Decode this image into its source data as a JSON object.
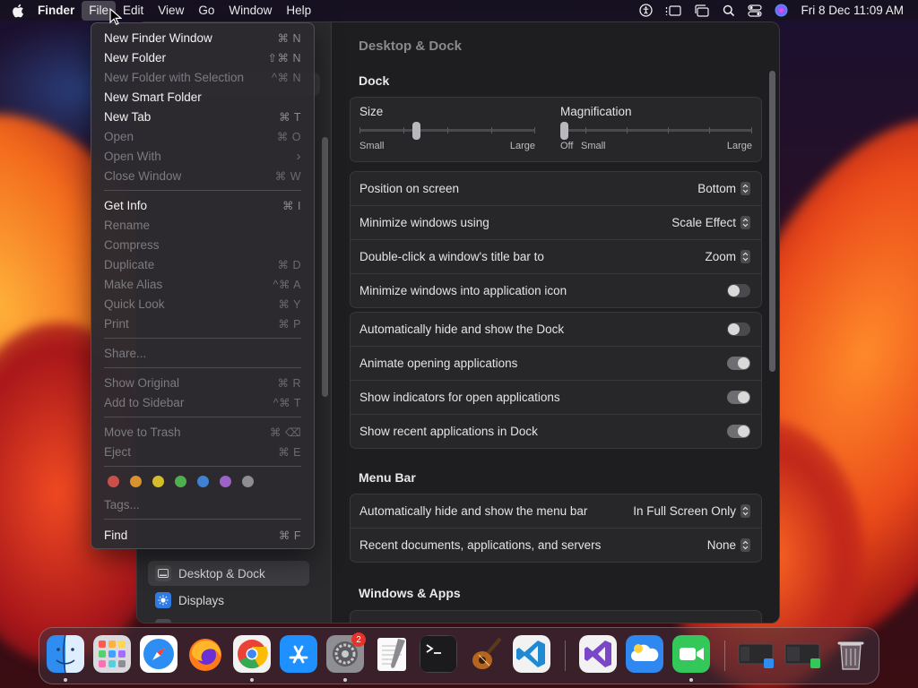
{
  "menubar": {
    "app_name": "Finder",
    "menus": [
      "File",
      "Edit",
      "View",
      "Go",
      "Window",
      "Help"
    ],
    "active_menu": "File",
    "clock": "Fri 8 Dec  11:09 AM"
  },
  "settings": {
    "pane_title": "Desktop & Dock",
    "sidebar": {
      "items": [
        {
          "label": "Desktop & Dock",
          "icon": "desktop-dock-icon",
          "selected": true
        },
        {
          "label": "Displays",
          "icon": "displays-icon",
          "selected": false
        }
      ]
    },
    "dock_section": {
      "title": "Dock",
      "size_slider": {
        "label": "Size",
        "min_label": "Small",
        "max_label": "Large",
        "value": 0.33
      },
      "magnification_slider": {
        "label": "Magnification",
        "off_label": "Off",
        "min_label": "Small",
        "max_label": "Large",
        "value": 0.0
      },
      "position_row": {
        "label": "Position on screen",
        "value": "Bottom"
      },
      "minimize_row": {
        "label": "Minimize windows using",
        "value": "Scale Effect"
      },
      "double_click_row": {
        "label": "Double-click a window's title bar to",
        "value": "Zoom"
      },
      "minimize_into_icon": {
        "label": "Minimize windows into application icon",
        "on": false
      },
      "auto_hide_dock": {
        "label": "Automatically hide and show the Dock",
        "on": false
      },
      "animate_opening": {
        "label": "Animate opening applications",
        "on": true
      },
      "show_indicators": {
        "label": "Show indicators for open applications",
        "on": true
      },
      "show_recent": {
        "label": "Show recent applications in Dock",
        "on": true
      }
    },
    "menu_bar_section": {
      "title": "Menu Bar",
      "auto_hide_menu_bar": {
        "label": "Automatically hide and show the menu bar",
        "value": "In Full Screen Only"
      },
      "recent_items": {
        "label": "Recent documents, applications, and servers",
        "value": "None"
      }
    },
    "windows_apps_section": {
      "title": "Windows & Apps"
    }
  },
  "file_menu": {
    "new_finder_window": {
      "label": "New Finder Window",
      "shortcut": "⌘ N"
    },
    "new_folder": {
      "label": "New Folder",
      "shortcut": "⇧⌘ N"
    },
    "new_folder_selection": {
      "label": "New Folder with Selection",
      "shortcut": "^⌘ N"
    },
    "new_smart_folder": {
      "label": "New Smart Folder",
      "shortcut": ""
    },
    "new_tab": {
      "label": "New Tab",
      "shortcut": "⌘ T"
    },
    "open": {
      "label": "Open",
      "shortcut": "⌘ O"
    },
    "open_with": {
      "label": "Open With",
      "shortcut": "›"
    },
    "close_window": {
      "label": "Close Window",
      "shortcut": "⌘ W"
    },
    "get_info": {
      "label": "Get Info",
      "shortcut": "⌘ I"
    },
    "rename": {
      "label": "Rename",
      "shortcut": ""
    },
    "compress": {
      "label": "Compress",
      "shortcut": ""
    },
    "duplicate": {
      "label": "Duplicate",
      "shortcut": "⌘ D"
    },
    "make_alias": {
      "label": "Make Alias",
      "shortcut": "^⌘ A"
    },
    "quick_look": {
      "label": "Quick Look",
      "shortcut": "⌘ Y"
    },
    "print": {
      "label": "Print",
      "shortcut": "⌘ P"
    },
    "share": {
      "label": "Share...",
      "shortcut": ""
    },
    "show_original": {
      "label": "Show Original",
      "shortcut": "⌘ R"
    },
    "add_to_sidebar": {
      "label": "Add to Sidebar",
      "shortcut": "^⌘ T"
    },
    "move_to_trash": {
      "label": "Move to Trash",
      "shortcut": "⌘ ⌫"
    },
    "eject": {
      "label": "Eject",
      "shortcut": "⌘ E"
    },
    "tags": {
      "label": "Tags...",
      "shortcut": ""
    },
    "find": {
      "label": "Find",
      "shortcut": "⌘ F"
    },
    "tag_colors": [
      "#c9504a",
      "#d8912f",
      "#d4bc2c",
      "#4fae4f",
      "#3f82d4",
      "#9b63c7",
      "#8e8e92"
    ]
  },
  "dock": {
    "apps": [
      "finder-icon",
      "launchpad-icon",
      "safari-icon",
      "firefox-icon",
      "chrome-icon",
      "app-store-icon",
      "system-settings-icon",
      "textedit-icon",
      "terminal-icon",
      "garageband-icon",
      "vscode-icon",
      "visual-studio-icon",
      "icloud-icon",
      "facetime-icon"
    ],
    "settings_badge": "2"
  }
}
